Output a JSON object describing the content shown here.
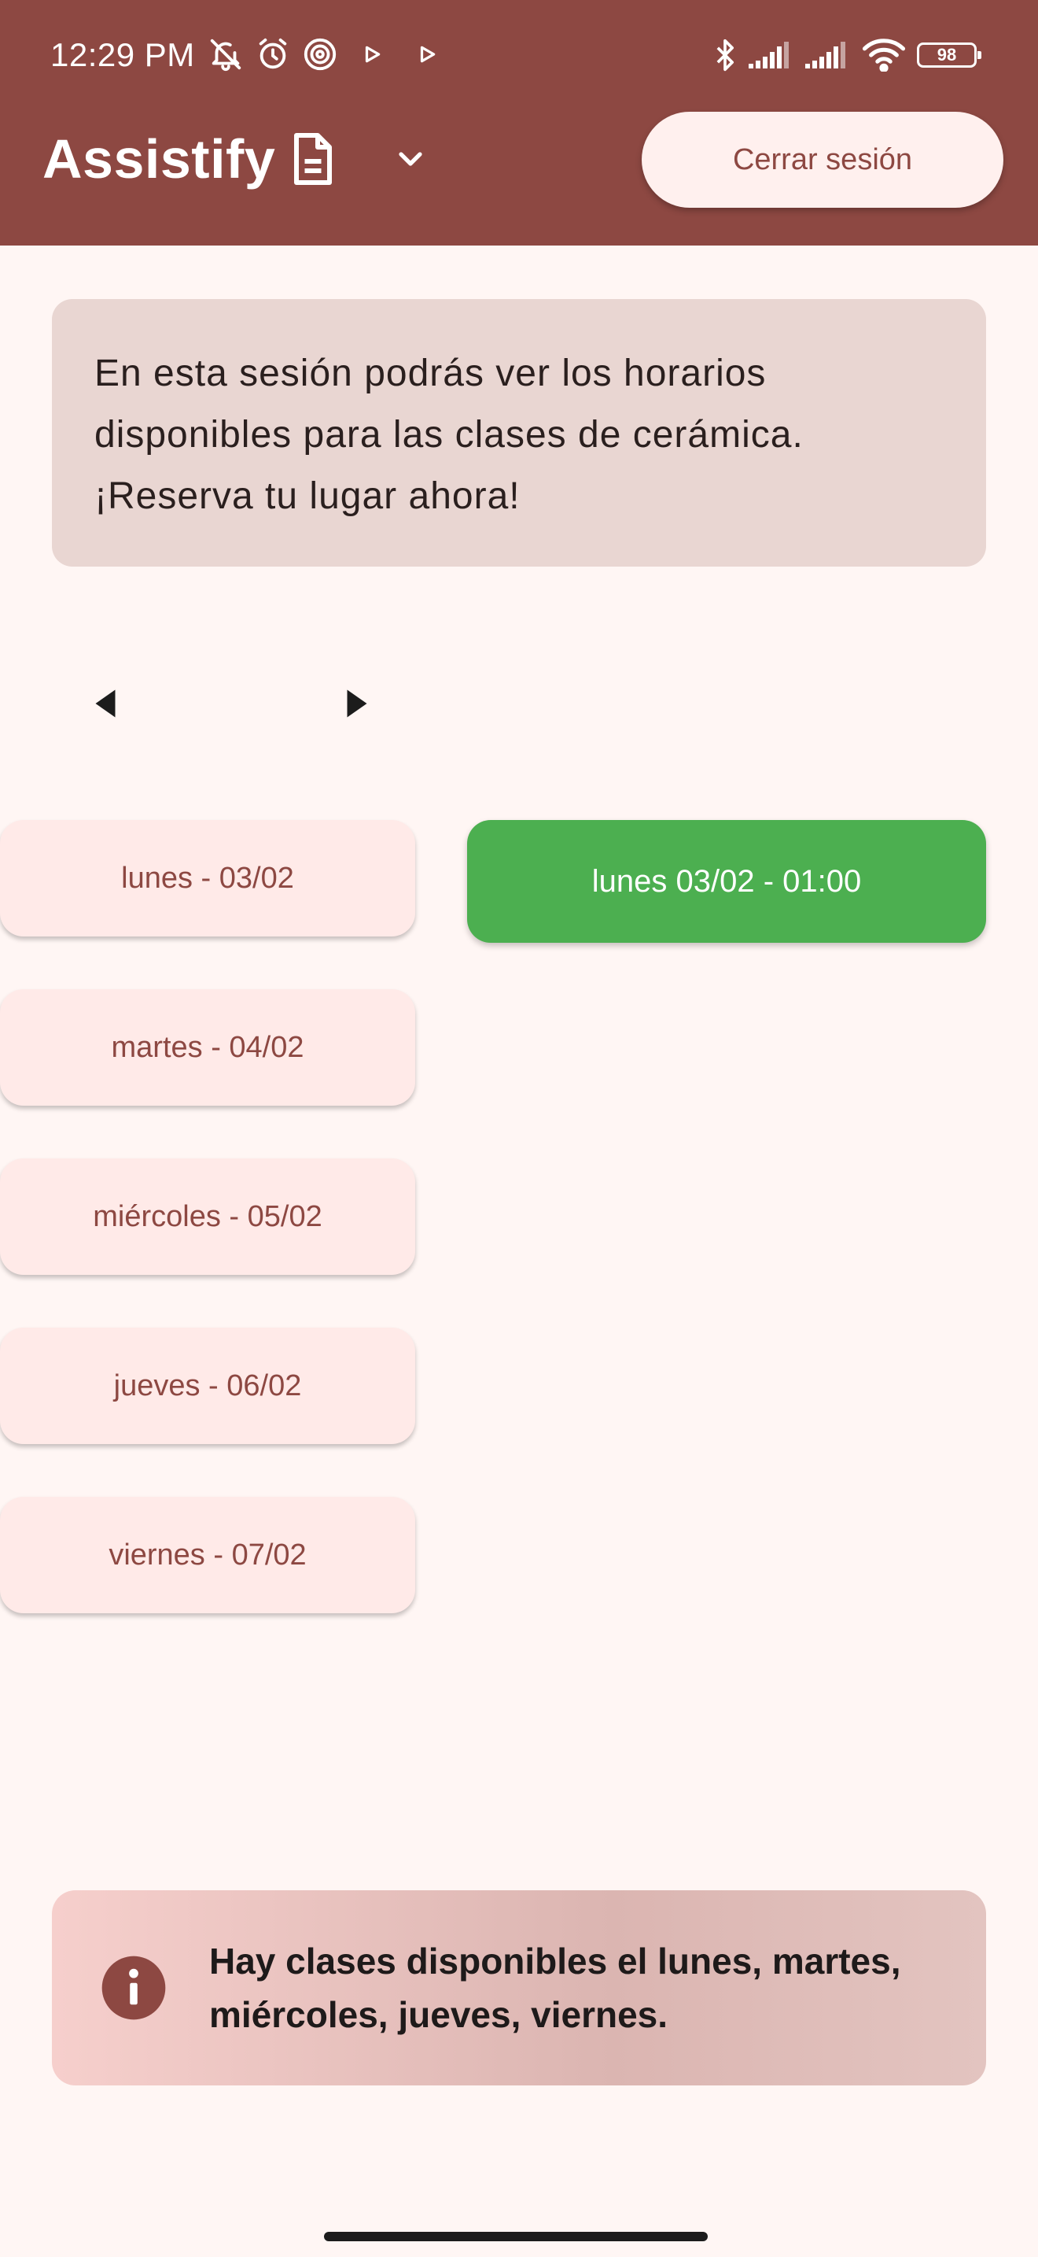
{
  "colors": {
    "primary": "#8d4842",
    "background": "#fff6f4",
    "intro_card": "#e9d6d2",
    "day_button": "#ffeae8",
    "slot_selected": "#4caf50",
    "on_primary": "#ffffff"
  },
  "status_bar": {
    "time": "12:29 PM",
    "battery": "98",
    "left_icons": [
      "muted-bell-icon",
      "alarm-icon",
      "location-target-icon",
      "play-icon",
      "play-icon"
    ],
    "right_icons": [
      "bluetooth-icon",
      "signal-icon",
      "signal-icon",
      "wifi-icon",
      "battery-icon"
    ]
  },
  "header": {
    "app_title": "Assistify",
    "title_icon": "document-icon",
    "dropdown_icon": "chevron-down-icon",
    "logout_label": "Cerrar sesión"
  },
  "intro": {
    "text": "En esta sesión podrás ver los horarios disponibles para las clases de cerámica. ¡Reserva tu lugar ahora!"
  },
  "navigation": {
    "prev_icon": "caret-left-icon",
    "next_icon": "caret-right-icon"
  },
  "days": [
    {
      "label": "lunes - 03/02"
    },
    {
      "label": "martes - 04/02"
    },
    {
      "label": "miércoles - 05/02"
    },
    {
      "label": "jueves - 06/02"
    },
    {
      "label": "viernes - 07/02"
    }
  ],
  "slots": [
    {
      "label": "lunes 03/02 - 01:00",
      "selected": true
    }
  ],
  "info_banner": {
    "icon": "info-icon",
    "text": "Hay clases disponibles el lunes, martes, miércoles, jueves, viernes."
  }
}
